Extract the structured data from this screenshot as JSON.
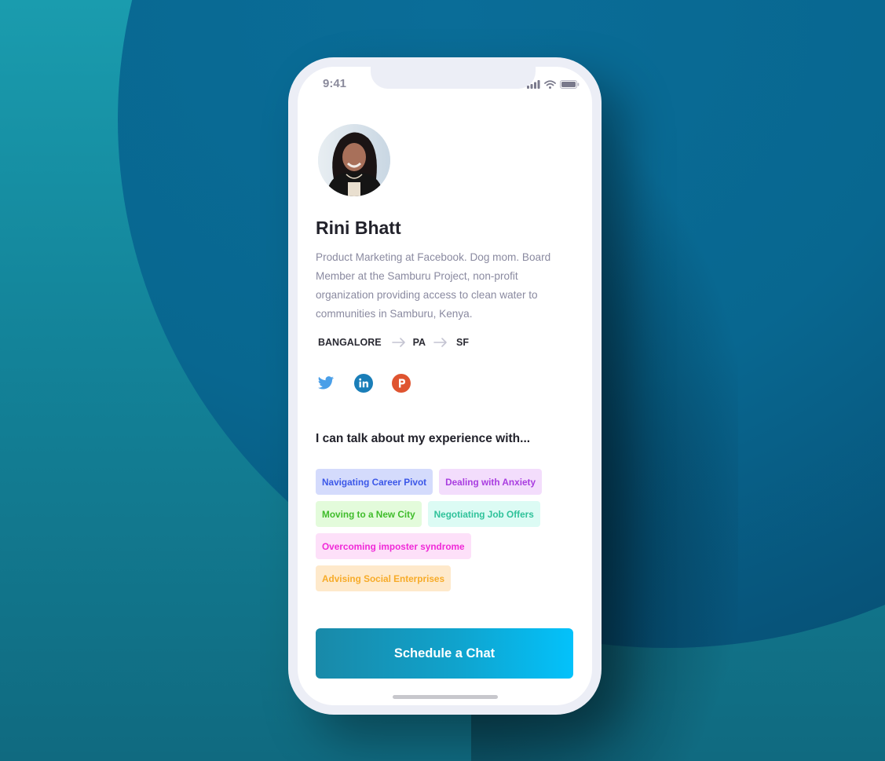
{
  "status_bar": {
    "time": "9:41",
    "icons": [
      "signal-icon",
      "wifi-icon",
      "battery-icon"
    ]
  },
  "profile": {
    "name": "Rini Bhatt",
    "bio": "Product Marketing at Facebook. Dog mom. Board Member at the Samburu Project, non-profit organization providing access to clean water to communities in Samburu, Kenya.",
    "route": [
      "BANGALORE",
      "PA",
      "SF"
    ],
    "social": [
      {
        "name": "twitter",
        "icon": "twitter-icon",
        "color": "#4a9fe8"
      },
      {
        "name": "linkedin",
        "icon": "linkedin-icon",
        "color": "#1a7eb8"
      },
      {
        "name": "producthunt",
        "icon": "product-hunt-icon",
        "color": "#df5430"
      }
    ]
  },
  "topics": {
    "title": "I can talk about my experience with...",
    "tags": [
      {
        "label": "Navigating Career Pivot",
        "text_color": "#3b57e8",
        "bg_color": "#d4dbfc"
      },
      {
        "label": "Dealing with Anxiety",
        "text_color": "#a93de0",
        "bg_color": "#f3ddfc"
      },
      {
        "label": "Moving to a New City",
        "text_color": "#3fbc2a",
        "bg_color": "#e3fbdb"
      },
      {
        "label": "Negotiating Job Offers",
        "text_color": "#2fc29a",
        "bg_color": "#dcfbf4"
      },
      {
        "label": "Overcoming imposter syndrome",
        "text_color": "#f02ad8",
        "bg_color": "#fde0f9"
      },
      {
        "label": "Advising Social Enterprises",
        "text_color": "#f7ab28",
        "bg_color": "#fee9cb"
      }
    ]
  },
  "cta": {
    "label": "Schedule a Chat"
  },
  "colors": {
    "accent_start": "#1989a8",
    "accent_end": "#03c2fb",
    "name_text": "#22222b",
    "bio_text": "#8a8aa0"
  }
}
